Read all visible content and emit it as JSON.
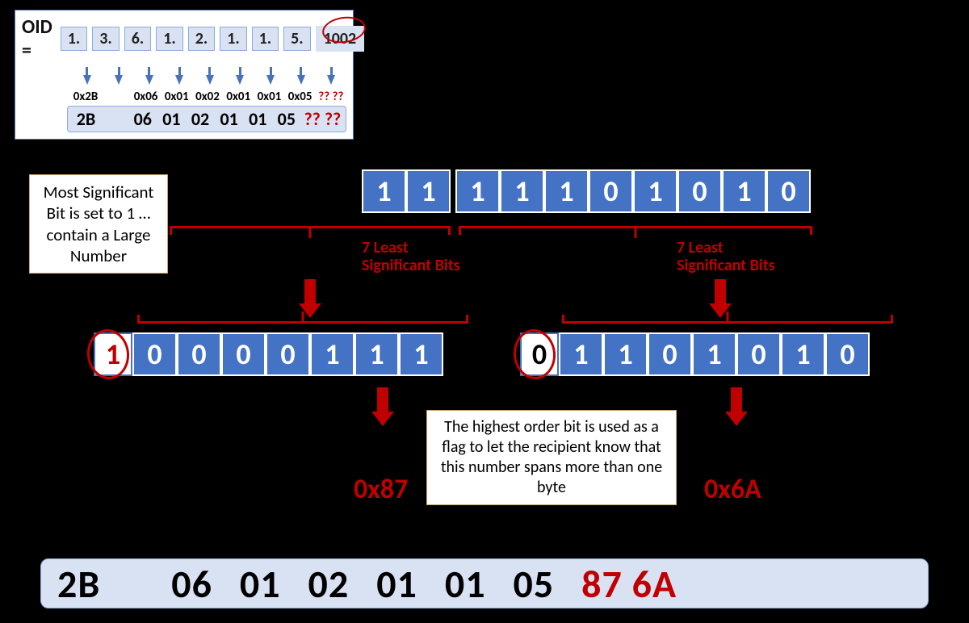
{
  "oid": {
    "label": "OID =",
    "components": [
      "1.",
      "3.",
      "6.",
      "1.",
      "2.",
      "1.",
      "1.",
      "5.",
      "1002"
    ],
    "hex_labels": [
      "0x2B",
      "0x06",
      "0x01",
      "0x02",
      "0x01",
      "0x01",
      "0x05",
      "?? ??"
    ],
    "encoded": [
      "2B",
      "06",
      "01",
      "02",
      "01",
      "01",
      "05",
      "?? ??"
    ]
  },
  "binary_1002": [
    "1",
    "1",
    "1",
    "1",
    "1",
    "0",
    "1",
    "0",
    "1",
    "0"
  ],
  "labels": {
    "seven_lsb": "7 Least\nSignificant Bits",
    "msb_note": "Most Significant Bit is set to 1  … contain a Large Number",
    "flag_note": "The highest order bit is used as a flag to let the recipient know that this number spans more than one byte"
  },
  "byte1": {
    "bits": [
      "1",
      "0",
      "0",
      "0",
      "0",
      "1",
      "1",
      "1"
    ],
    "hex": "0x87"
  },
  "byte2": {
    "bits": [
      "0",
      "1",
      "1",
      "0",
      "1",
      "0",
      "1",
      "0"
    ],
    "hex": "0x6A"
  },
  "final_row": [
    "2B",
    "06",
    "01",
    "02",
    "01",
    "01",
    "05",
    "87 6A"
  ]
}
